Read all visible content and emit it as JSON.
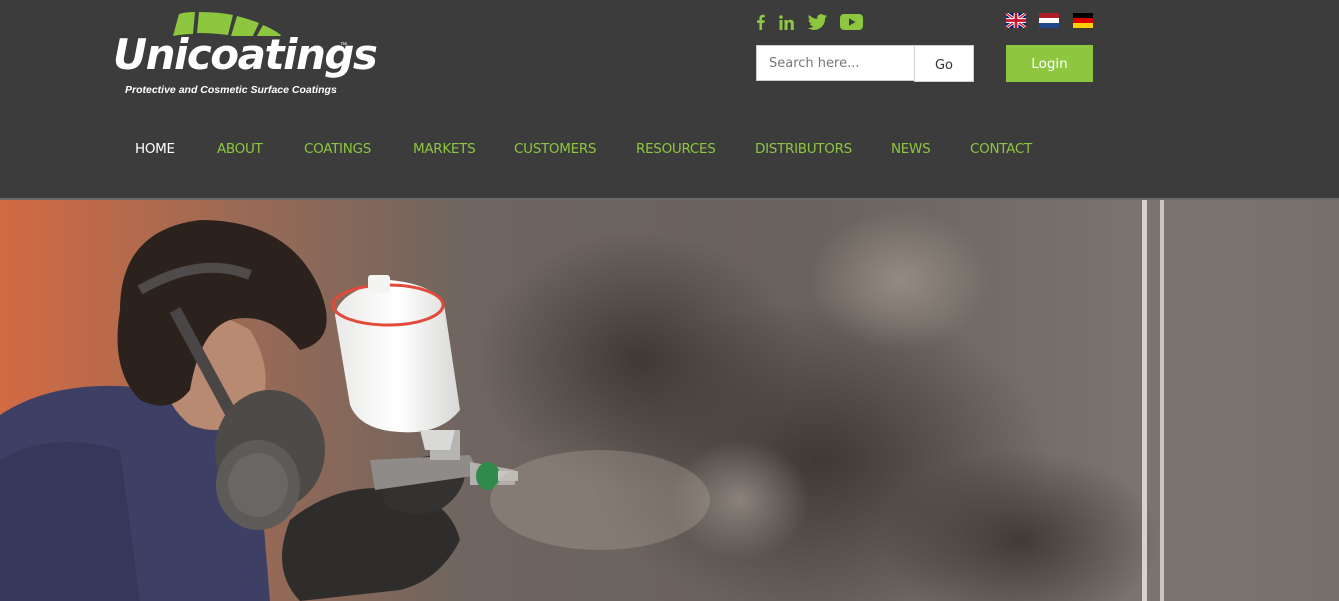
{
  "brand": {
    "name": "Unicoatings",
    "trademark": "™",
    "tagline": "Protective and Cosmetic Surface Coatings"
  },
  "colors": {
    "header_bg": "#3c3c3c",
    "accent_green": "#8dc63f",
    "nav_active": "#ffffff"
  },
  "social": [
    {
      "name": "facebook",
      "icon": "facebook-icon"
    },
    {
      "name": "linkedin",
      "icon": "linkedin-icon"
    },
    {
      "name": "twitter",
      "icon": "twitter-icon"
    },
    {
      "name": "youtube",
      "icon": "youtube-icon"
    }
  ],
  "languages": [
    {
      "code": "en",
      "icon": "uk-flag-icon"
    },
    {
      "code": "nl",
      "icon": "netherlands-flag-icon"
    },
    {
      "code": "de",
      "icon": "germany-flag-icon"
    }
  ],
  "search": {
    "placeholder": "Search here...",
    "value": "",
    "go_label": "Go"
  },
  "login": {
    "label": "Login"
  },
  "nav": {
    "items": [
      {
        "label": "HOME",
        "active": true
      },
      {
        "label": "ABOUT",
        "active": false
      },
      {
        "label": "COATINGS",
        "active": false
      },
      {
        "label": "MARKETS",
        "active": false
      },
      {
        "label": "CUSTOMERS",
        "active": false
      },
      {
        "label": "RESOURCES",
        "active": false
      },
      {
        "label": "DISTRIBUTORS",
        "active": false
      },
      {
        "label": "NEWS",
        "active": false
      },
      {
        "label": "CONTACT",
        "active": false
      }
    ]
  },
  "hero": {
    "image": "hero-image-spray-painter"
  }
}
